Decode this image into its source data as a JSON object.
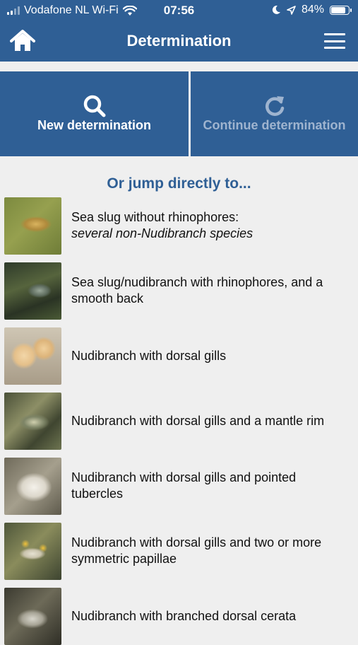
{
  "status_bar": {
    "carrier": "Vodafone NL Wi-Fi",
    "time": "07:56",
    "battery": "84%",
    "battery_level": 0.84
  },
  "header": {
    "title": "Determination"
  },
  "actions": {
    "new_label": "New determination",
    "continue_label": "Continue determination"
  },
  "jump_title": "Or jump directly to...",
  "items": [
    {
      "title": "Sea slug without rhinophores:",
      "subtitle": "several non-Nudibranch species"
    },
    {
      "title": "Sea slug/nudibranch with rhinophores, and a smooth back",
      "subtitle": ""
    },
    {
      "title": "Nudibranch with dorsal gills",
      "subtitle": ""
    },
    {
      "title": "Nudibranch with dorsal gills and a mantle rim",
      "subtitle": ""
    },
    {
      "title": "Nudibranch with dorsal gills and pointed tubercles",
      "subtitle": ""
    },
    {
      "title": "Nudibranch with dorsal gills and two or more symmetric papillae",
      "subtitle": ""
    },
    {
      "title": "Nudibranch with branched dorsal cerata",
      "subtitle": ""
    }
  ],
  "colors": {
    "brand": "#2f5f95",
    "background": "#efefef",
    "disabled_text": "#9fb4cf"
  }
}
